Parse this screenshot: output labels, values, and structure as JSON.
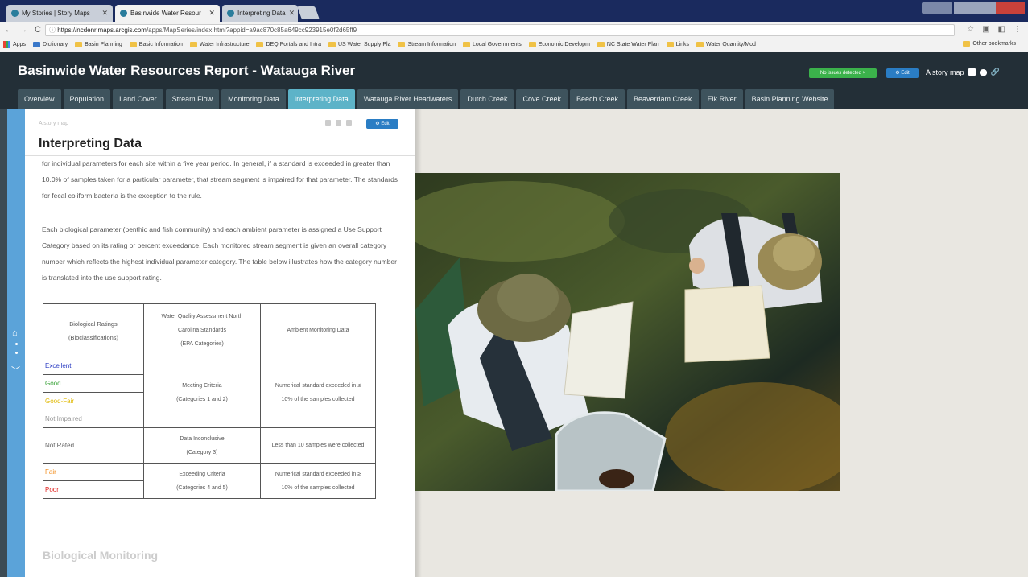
{
  "browser": {
    "tabs": [
      {
        "label": "My Stories | Story Maps"
      },
      {
        "label": "Basinwide Water Resour"
      },
      {
        "label": "Interpreting Data"
      }
    ],
    "url_host": "https://ncdenr.maps.arcgis.com",
    "url_path": "/apps/MapSeries/index.html?appid=a9ac870c85a649cc923915e0f2d65ff9",
    "bookmarks": [
      "Apps",
      "Dictionary",
      "Basin Planning",
      "Basic Information",
      "Water Infrastructure",
      "DEQ Portals and Intra",
      "US Water Supply Pla",
      "Stream Information",
      "Local Governments",
      "Economic Developm",
      "NC State Water Plan",
      "Links",
      "Water Quantity/Mod"
    ],
    "other_bookmarks": "Other bookmarks"
  },
  "header": {
    "title": "Basinwide Water Resources Report - Watauga River",
    "no_issues": "No issues detected",
    "edit": "Edit",
    "story_map": "A story map"
  },
  "nav_tabs": [
    "Overview",
    "Population",
    "Land Cover",
    "Stream Flow",
    "Monitoring Data",
    "Interpreting Data",
    "Watauga River Headwaters",
    "Dutch Creek",
    "Cove Creek",
    "Beech Creek",
    "Beaverdam Creek",
    "Elk River",
    "Basin Planning Website"
  ],
  "panel": {
    "story_map": "A story map",
    "edit": "Edit",
    "title": "Interpreting Data",
    "para1": "for individual parameters for each site within a five year period. In general, if a standard is exceeded in greater than 10.0% of samples taken for a particular parameter, that stream segment is impaired for that parameter. The standards for fecal coliform bacteria is the exception to the rule.",
    "para2": "Each biological parameter (benthic and fish community) and each ambient parameter is assigned a Use Support Category based on its rating or percent exceedance. Each monitored stream segment is given an overall category number which reflects the highest individual parameter category. The table below illustrates how the category number is translated into the use support rating.",
    "next_heading": "Biological Monitoring"
  },
  "table": {
    "headers": {
      "bio_line1": "Biological Ratings",
      "bio_line2": "(Bioclassifications)",
      "wq_line1": "Water Quality Assessment North",
      "wq_line2": "Carolina Standards",
      "wq_line3": "(EPA Categories)",
      "ambient": "Ambient Monitoring Data"
    },
    "ratings": {
      "excellent": "Excellent",
      "good": "Good",
      "good_fair": "Good-Fair",
      "not_impaired": "Not Impaired",
      "not_rated": "Not Rated",
      "fair": "Fair",
      "poor": "Poor"
    },
    "meeting": {
      "line1": "Meeting Criteria",
      "line2": "(Categories 1 and 2)",
      "amb1": "Numerical standard exceeded in ≤",
      "amb2": "10% of the samples collected"
    },
    "inconclusive": {
      "line1": "Data Inconclusive",
      "line2": "(Category 3)",
      "amb": "Less than 10 samples were collected"
    },
    "exceeding": {
      "line1": "Exceeding Criteria",
      "line2": "(Categories 4 and 5)",
      "amb1": "Numerical standard exceeded in ≥",
      "amb2": "10% of the samples collected"
    }
  },
  "colors": {
    "header_bg": "#232f37",
    "tab_active": "#5db3c8",
    "sidebar": "#5ba3d9",
    "excellent": "#2b3cc2",
    "good": "#3aa33a",
    "good_fair": "#e0b800",
    "fair": "#f28c1a",
    "poor": "#e0201c"
  }
}
